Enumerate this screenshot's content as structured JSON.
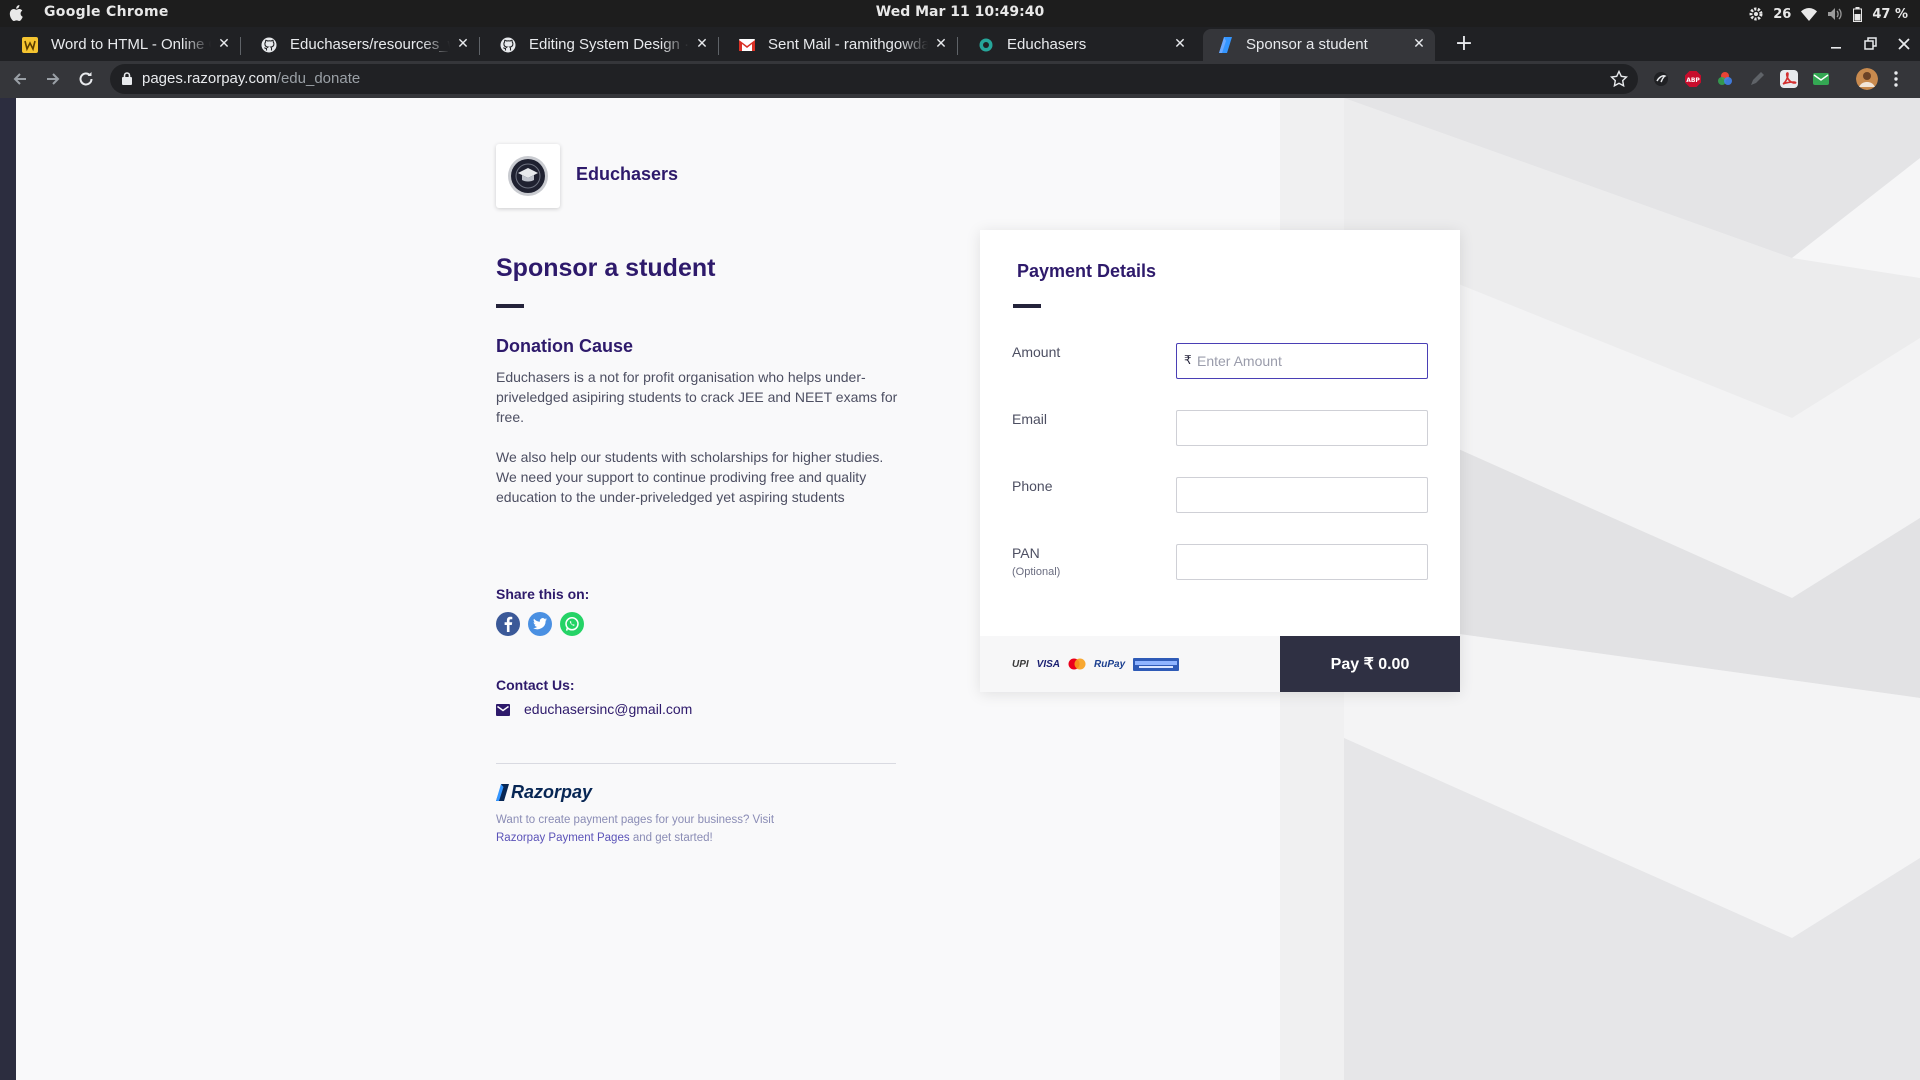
{
  "os_bar": {
    "app_name": "Google Chrome",
    "datetime": "Wed Mar 11  10:49:40",
    "notification_count": "26",
    "battery": "47 %"
  },
  "browser": {
    "tabs": [
      {
        "title": "Word to HTML - Online Co",
        "icon": "word-to-html-icon"
      },
      {
        "title": "Educhasers/resources_wi",
        "icon": "github-icon"
      },
      {
        "title": "Editing System Design · ra",
        "icon": "github-icon"
      },
      {
        "title": "Sent Mail - ramithgowdak",
        "icon": "gmail-icon"
      },
      {
        "title": "Educhasers",
        "icon": "educhasers-icon"
      },
      {
        "title": "Sponsor a student",
        "icon": "razorpay-icon",
        "active": true
      }
    ],
    "url_host": "pages.razorpay.com",
    "url_path": "/edu_donate"
  },
  "page": {
    "brand_name": "Educhasers",
    "title": "Sponsor a student",
    "cause_title": "Donation Cause",
    "cause_paragraph_1": "Educhasers is a not for profit organisation who helps under-priveledged asipiring students to crack JEE and NEET exams for free.",
    "cause_paragraph_2": "We also help our students with scholarships for higher studies. We need your support to continue prodiving free and quality education to the under-priveledged yet aspiring students",
    "share_label": "Share this on:",
    "contact_label": "Contact Us:",
    "contact_email": "educhasersinc@gmail.com",
    "razorpay_wordmark": "Razorpay",
    "footer_text_1": "Want to create payment pages for your business? Visit",
    "footer_link": "Razorpay Payment Pages",
    "footer_text_2": "and get started!"
  },
  "payment": {
    "title": "Payment Details",
    "fields": [
      {
        "label": "Amount",
        "placeholder": "Enter Amount",
        "value": "",
        "currency": "₹"
      },
      {
        "label": "Email",
        "placeholder": "",
        "value": ""
      },
      {
        "label": "Phone",
        "placeholder": "",
        "value": ""
      },
      {
        "label": "PAN",
        "sublabel": "(Optional)",
        "placeholder": "",
        "value": ""
      }
    ],
    "methods": [
      "UPI",
      "VISA",
      "Mastercard",
      "RuPay",
      "Net Banking"
    ],
    "pay_button": "Pay  ₹ 0.00"
  },
  "colors": {
    "brand_text": "#2e1a6b",
    "pay_button": "#2f3043",
    "focus_border": "#4a3fb5",
    "facebook": "#3b5998",
    "twitter": "#1da1f2",
    "whatsapp": "#25d366"
  }
}
